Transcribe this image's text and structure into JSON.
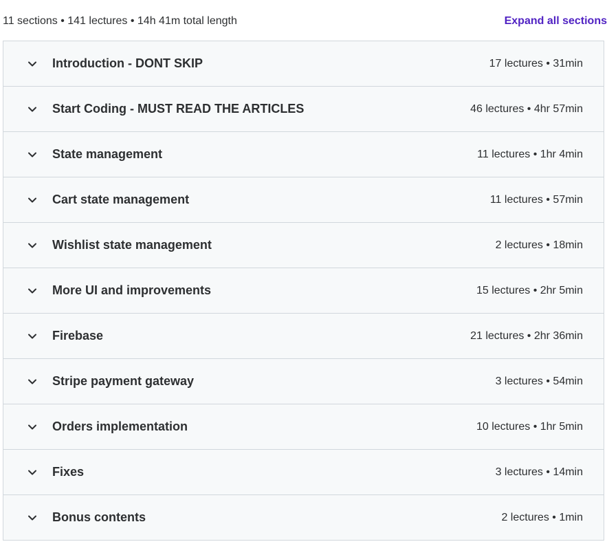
{
  "header": {
    "summary": "11 sections • 141 lectures • 14h 41m total length",
    "expand_all_label": "Expand all sections"
  },
  "colors": {
    "accent": "#5022c3",
    "row_background": "#f7f9fa",
    "border": "#d1d7dc",
    "text": "#2d2f31"
  },
  "sections": [
    {
      "title": "Introduction - DONT SKIP",
      "meta": "17 lectures • 31min",
      "icon": "chevron-down-icon"
    },
    {
      "title": "Start Coding - MUST READ THE ARTICLES",
      "meta": "46 lectures • 4hr 57min",
      "icon": "chevron-down-icon"
    },
    {
      "title": "State management",
      "meta": "11 lectures • 1hr 4min",
      "icon": "chevron-down-icon"
    },
    {
      "title": "Cart state management",
      "meta": "11 lectures • 57min",
      "icon": "chevron-down-icon"
    },
    {
      "title": "Wishlist state management",
      "meta": "2 lectures • 18min",
      "icon": "chevron-down-icon"
    },
    {
      "title": "More UI and improvements",
      "meta": "15 lectures • 2hr 5min",
      "icon": "chevron-down-icon"
    },
    {
      "title": "Firebase",
      "meta": "21 lectures • 2hr 36min",
      "icon": "chevron-down-icon"
    },
    {
      "title": "Stripe payment gateway",
      "meta": "3 lectures • 54min",
      "icon": "chevron-down-icon"
    },
    {
      "title": "Orders implementation",
      "meta": "10 lectures • 1hr 5min",
      "icon": "chevron-down-icon"
    },
    {
      "title": "Fixes",
      "meta": "3 lectures • 14min",
      "icon": "chevron-down-icon"
    },
    {
      "title": "Bonus contents",
      "meta": "2 lectures • 1min",
      "icon": "chevron-down-icon"
    }
  ]
}
